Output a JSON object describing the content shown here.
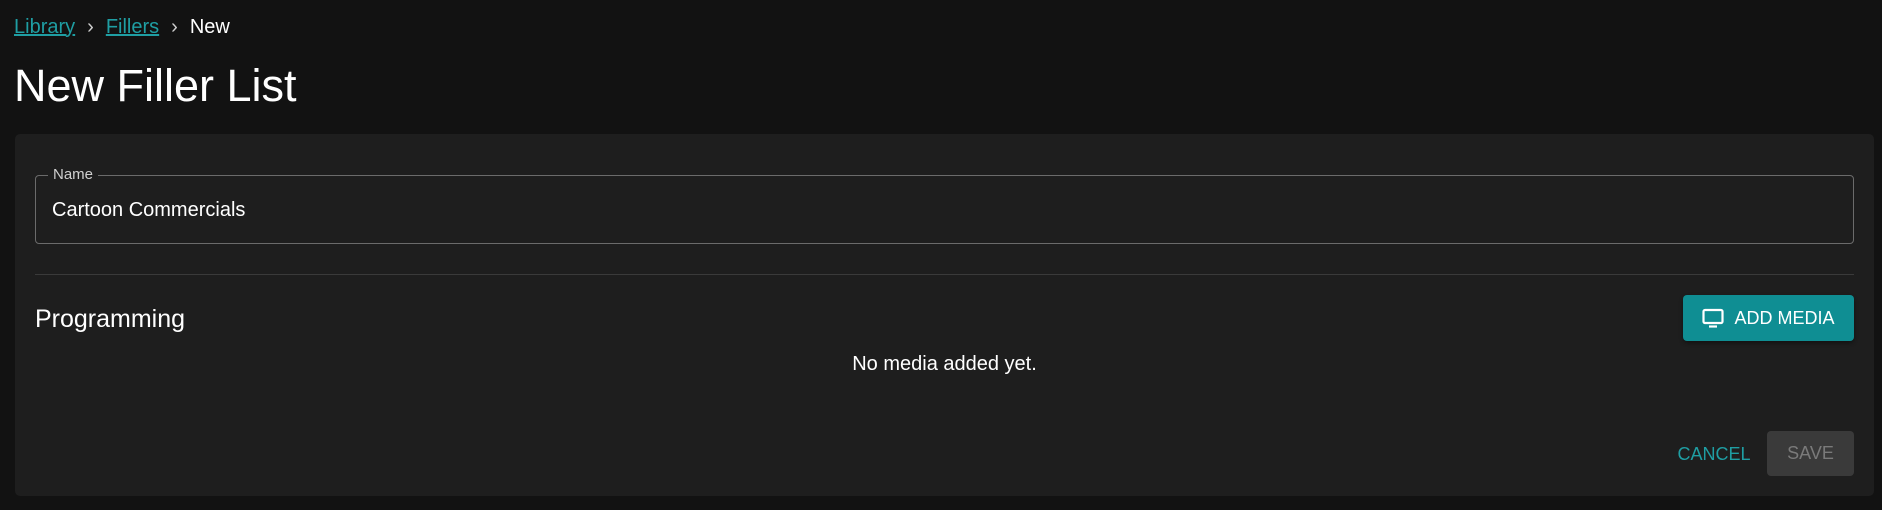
{
  "breadcrumb": {
    "items": [
      {
        "label": "Library"
      },
      {
        "label": "Fillers"
      },
      {
        "label": "New"
      }
    ],
    "separator": "›"
  },
  "page": {
    "title": "New Filler List"
  },
  "form": {
    "name_label": "Name",
    "name_value": "Cartoon Commercials"
  },
  "programming": {
    "title": "Programming",
    "add_media_label": "ADD MEDIA",
    "add_media_icon": "tv-icon",
    "empty_message": "No media added yet."
  },
  "actions": {
    "cancel_label": "CANCEL",
    "save_label": "SAVE"
  },
  "colors": {
    "accent": "#0f8e93",
    "link": "#1f9ea3",
    "background": "#121212",
    "card": "#1e1e1e"
  }
}
